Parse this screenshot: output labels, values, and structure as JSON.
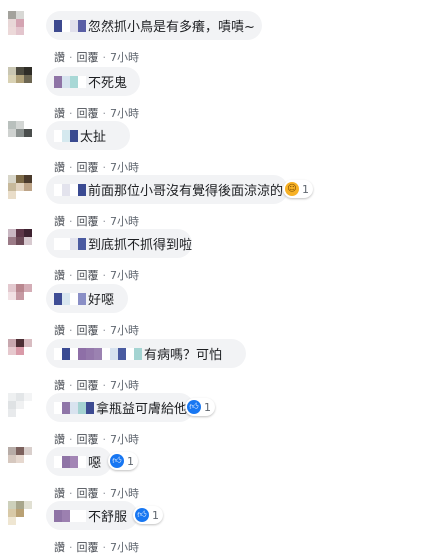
{
  "colors": {
    "bubble": "#f2f3f5",
    "link": "#4b4f56",
    "time": "#606770",
    "like": "#1877f2",
    "haha": "#f7b125"
  },
  "actions": {
    "like": "讚",
    "reply": "回覆",
    "sep": "·"
  },
  "comments": [
    {
      "text": "忽然抓小鳥是有多癢，嘖嘖~",
      "time": "7小時",
      "reaction": null,
      "count": null
    },
    {
      "text": "不死鬼",
      "time": "7小時",
      "reaction": null,
      "count": null
    },
    {
      "text": "太扯",
      "time": "7小時",
      "reaction": null,
      "count": null
    },
    {
      "text": "前面那位小哥沒有覺得後面涼涼的",
      "time": "7小時",
      "reaction": "haha-icon",
      "count": "1"
    },
    {
      "text": "到底抓不抓得到啦",
      "time": "7小時",
      "reaction": null,
      "count": null
    },
    {
      "text": "好噁",
      "time": "7小時",
      "reaction": null,
      "count": null
    },
    {
      "text": "有病嗎？可怕",
      "time": "7小時",
      "reaction": null,
      "count": null
    },
    {
      "text": "拿瓶益可膚給他",
      "time": "7小時",
      "reaction": "like-icon",
      "count": "1"
    },
    {
      "text": "噁",
      "time": "7小時",
      "reaction": "like-icon",
      "count": "1"
    },
    {
      "text": "不舒服",
      "time": "7小時",
      "reaction": "like-icon",
      "count": "1"
    }
  ]
}
